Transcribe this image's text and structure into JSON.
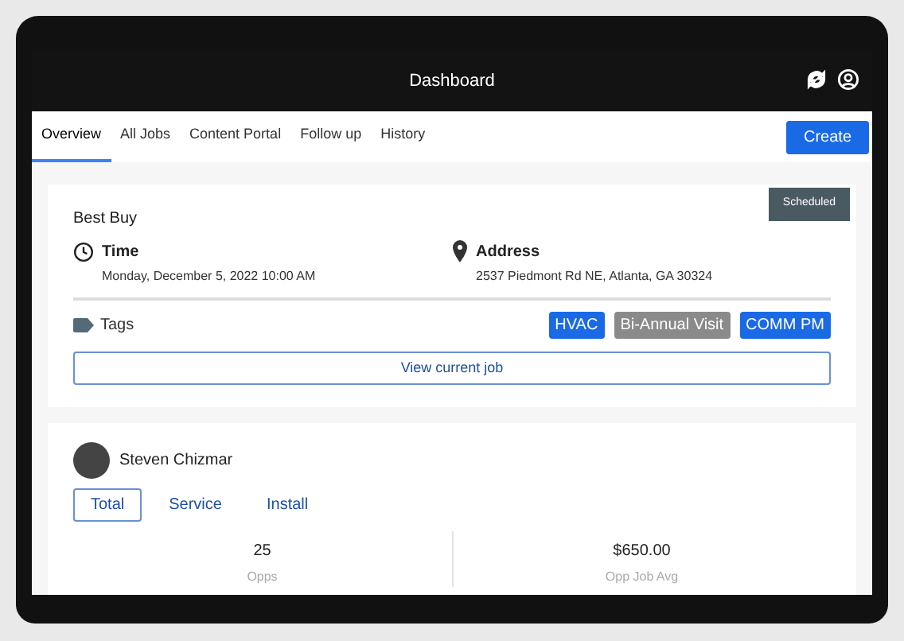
{
  "header": {
    "title": "Dashboard"
  },
  "tabs": [
    {
      "label": "Overview",
      "selected": true
    },
    {
      "label": "All Jobs",
      "selected": false
    },
    {
      "label": "Content Portal",
      "selected": false
    },
    {
      "label": "Follow up",
      "selected": false
    },
    {
      "label": "History",
      "selected": false
    }
  ],
  "create_button": "Create",
  "job_card": {
    "status": "Scheduled",
    "customer": "Best Buy",
    "time_label": "Time",
    "time_value": "Monday, December 5, 2022 10:00 AM",
    "address_label": "Address",
    "address_value": "2537 Piedmont Rd NE, Atlanta, GA 30324",
    "tags_label": "Tags",
    "tags": [
      {
        "label": "HVAC",
        "color": "#1a6ae6"
      },
      {
        "label": "Bi-Annual Visit",
        "color": "#8a8a8a"
      },
      {
        "label": "COMM PM",
        "color": "#1a6ae6"
      }
    ],
    "view_button": "View current job"
  },
  "tech_card": {
    "name": "Steven Chizmar",
    "filters": [
      {
        "label": "Total",
        "selected": true
      },
      {
        "label": "Service",
        "selected": false
      },
      {
        "label": "Install",
        "selected": false
      }
    ],
    "stats": [
      {
        "value": "25",
        "label": "Opps"
      },
      {
        "value": "$650.00",
        "label": "Opp Job Avg"
      }
    ]
  }
}
